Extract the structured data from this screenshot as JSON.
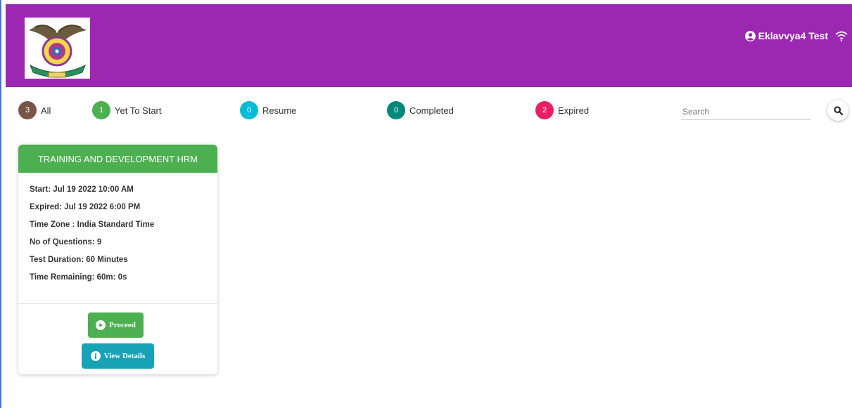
{
  "header": {
    "logo_alt": "Bharati Vidyapeeth Deemed University",
    "user_name": "Eklavvya4 Test"
  },
  "filters": [
    {
      "count": "3",
      "label": "All",
      "color": "#795548"
    },
    {
      "count": "1",
      "label": "Yet To Start",
      "color": "#4caf50"
    },
    {
      "count": "0",
      "label": "Resume",
      "color": "#00bcd4"
    },
    {
      "count": "0",
      "label": "Completed",
      "color": "#00897b"
    },
    {
      "count": "2",
      "label": "Expired",
      "color": "#e91e63"
    }
  ],
  "search": {
    "placeholder": "Search"
  },
  "card": {
    "title": "TRAINING AND DEVELOPMENT HRM",
    "start": "Start: Jul 19 2022 10:00 AM",
    "expired": "Expired: Jul 19 2022 6:00 PM",
    "timezone": "Time Zone : India Standard Time",
    "questions": "No of Questions: 9",
    "duration": "Test Duration: 60 Minutes",
    "remaining": "Time Remaining: 60m: 0s",
    "proceed_label": "Proceed",
    "details_label": "View Details"
  },
  "icons": [
    "user-icon",
    "wifi-icon",
    "search-icon",
    "play-icon",
    "info-icon"
  ],
  "colors": {
    "header": "#9c27b0",
    "card_header": "#4caf50",
    "details_button": "#17a2b8"
  }
}
